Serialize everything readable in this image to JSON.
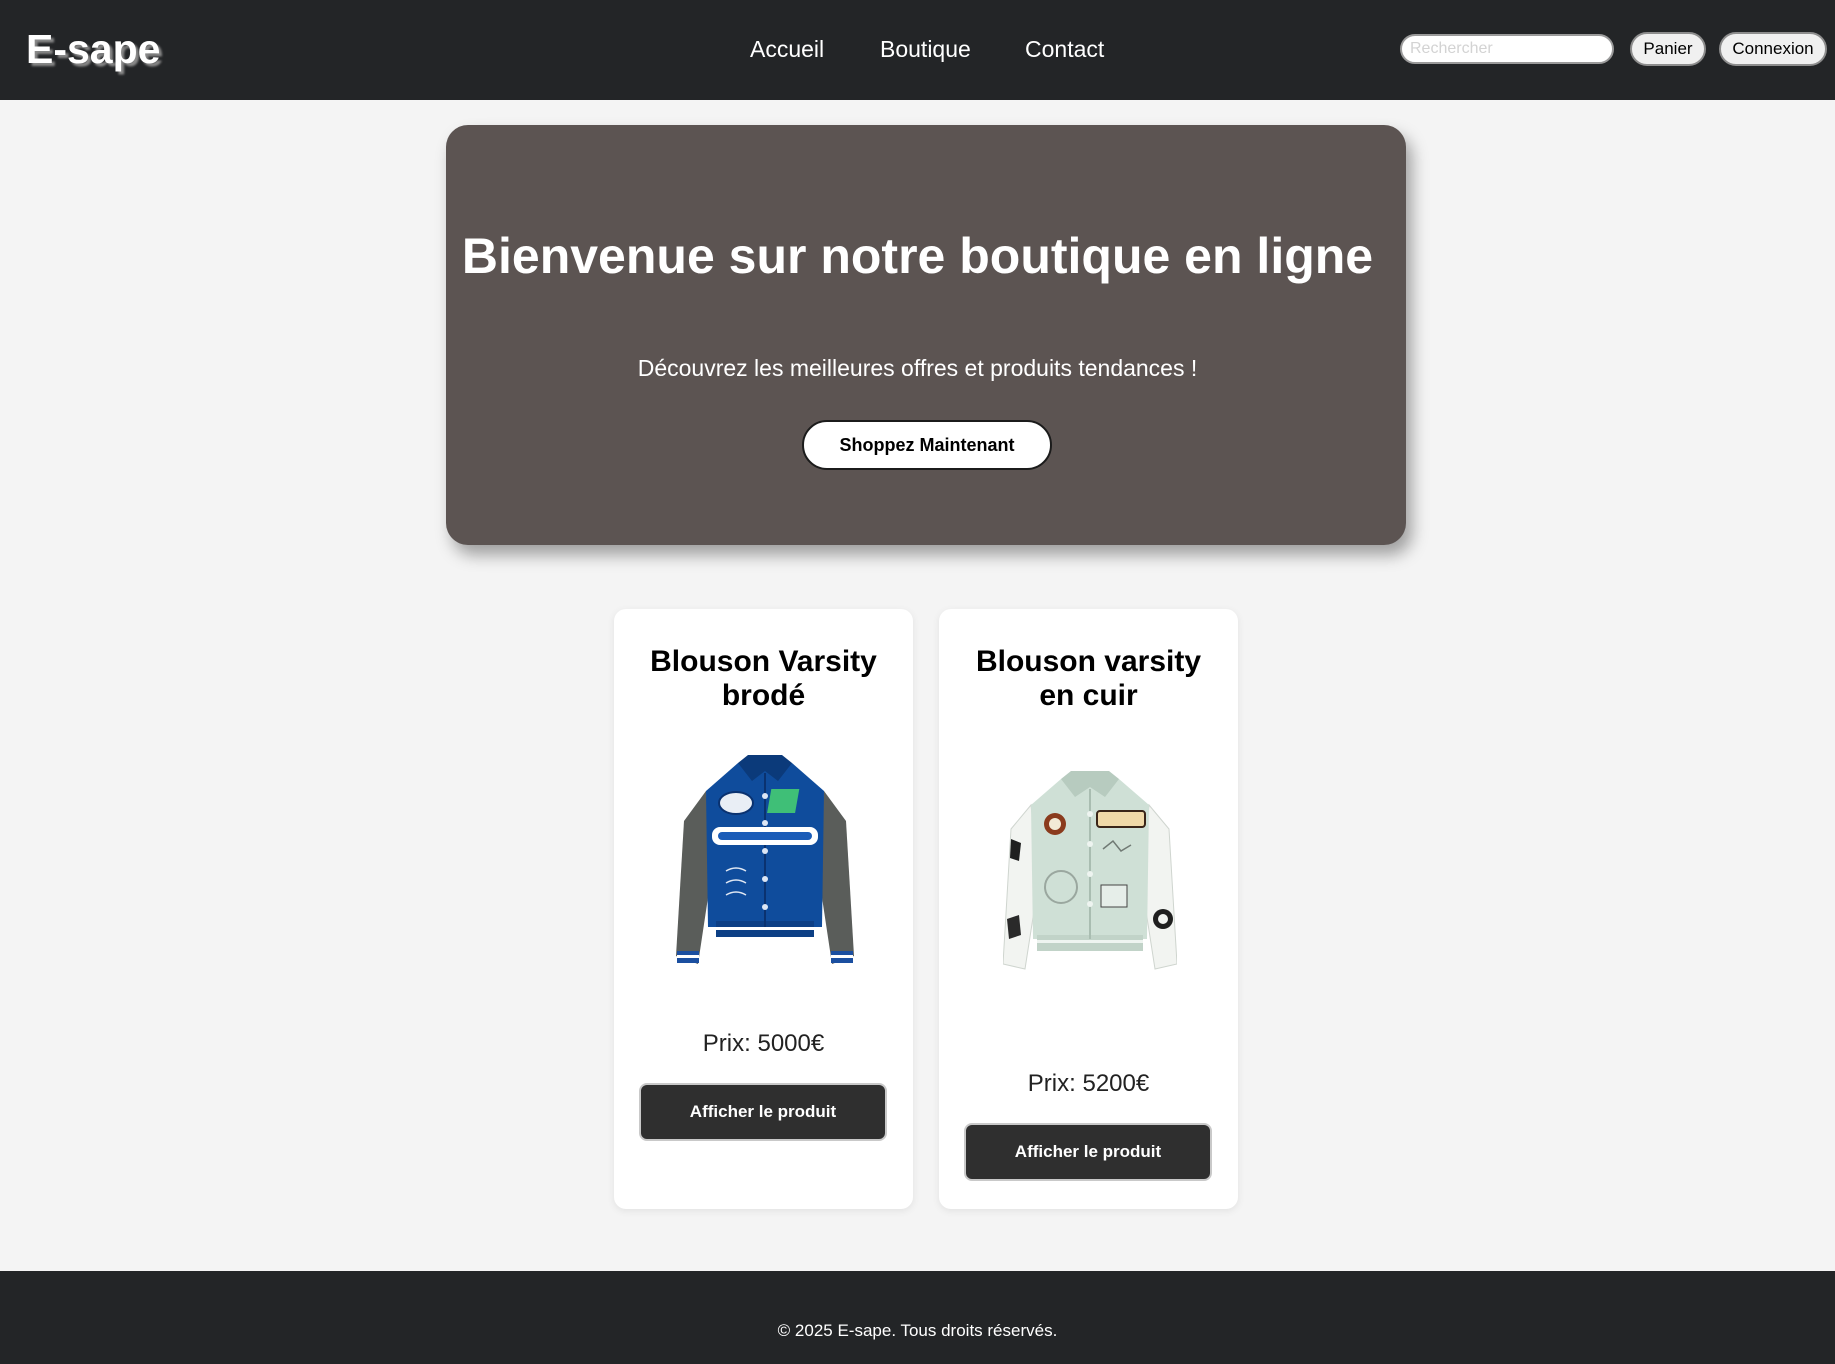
{
  "header": {
    "logo": "E-sape",
    "nav": [
      "Accueil",
      "Boutique",
      "Contact"
    ],
    "search_placeholder": "Rechercher",
    "cart_label": "Panier",
    "login_label": "Connexion"
  },
  "hero": {
    "title": "Bienvenue sur notre boutique en ligne",
    "subtitle": "Découvrez les meilleures offres et produits tendances !",
    "cta_label": "Shoppez Maintenant"
  },
  "products": [
    {
      "title_line1": "Blouson Varsity",
      "title_line2": "brodé",
      "image_icon": "blue-varsity-jacket-image",
      "price": "Prix: 5000€",
      "button_label": "Afficher le produit"
    },
    {
      "title_line1": "Blouson varsity",
      "title_line2": "en cuir",
      "image_icon": "mint-leather-varsity-jacket-image",
      "price": "Prix: 5200€",
      "button_label": "Afficher le produit"
    }
  ],
  "footer": {
    "text": "© 2025 E-sape. Tous droits réservés."
  },
  "colors": {
    "header_bg": "#232527",
    "hero_bg": "#5c5452",
    "page_bg": "#f4f4f4",
    "button_dark": "#2f2f2f"
  }
}
